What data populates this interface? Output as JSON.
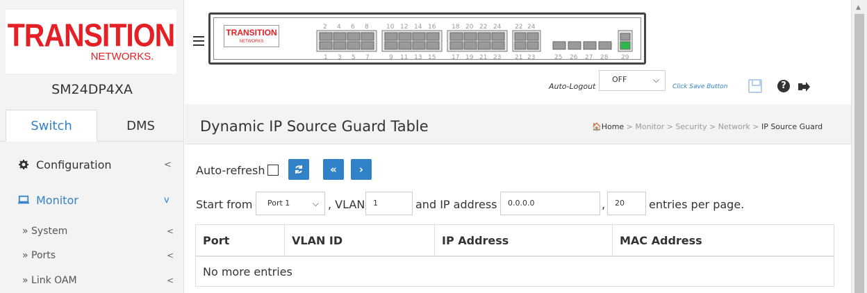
{
  "brand": {
    "logo_word": "TRANSITION",
    "logo_sub": "NETWORKS.",
    "mini_logo_word": "TRANSITION",
    "mini_logo_sub": "NETWORKS",
    "red": "#e41f26",
    "accent": "#3282c8"
  },
  "device": {
    "model": "SM24DP4XA",
    "ports_top": [
      "2",
      "4",
      "6",
      "8",
      "10",
      "12",
      "14",
      "16",
      "18",
      "20",
      "22",
      "24",
      "22",
      "24"
    ],
    "ports_bottom": [
      "1",
      "3",
      "5",
      "7",
      "9",
      "11",
      "13",
      "15",
      "17",
      "19",
      "21",
      "23",
      "21",
      "23",
      "25",
      "26",
      "27",
      "28",
      "29"
    ]
  },
  "sidebar": {
    "tabs": [
      {
        "label": "Switch",
        "active": true
      },
      {
        "label": "DMS",
        "active": false
      }
    ],
    "items": [
      {
        "label": "Configuration",
        "icon": "gear-icon",
        "chevron": "<"
      },
      {
        "label": "Monitor",
        "icon": "monitor-icon",
        "chevron": "v"
      }
    ],
    "subitems": [
      {
        "label": "» System",
        "chevron": "<"
      },
      {
        "label": "» Ports",
        "chevron": "<"
      },
      {
        "label": "» Link OAM",
        "chevron": "<"
      }
    ]
  },
  "topbar": {
    "auto_logout_label": "Auto-Logout",
    "auto_logout_value": "OFF",
    "click_save_label": "Click Save Button"
  },
  "page": {
    "title": "Dynamic IP Source Guard Table",
    "breadcrumb": {
      "home": "Home",
      "path": " > Monitor > Security > Network > ",
      "current": "IP Source Guard"
    }
  },
  "controls": {
    "auto_refresh_label": "Auto-refresh",
    "auto_refresh_checked": false,
    "refresh_glyph": "⇄",
    "first_glyph": "«",
    "next_glyph": "›",
    "start_from_label": "Start from",
    "port_value": "Port 1",
    "vlan_label": ", VLAN",
    "vlan_value": "1",
    "ip_label": "and IP address",
    "ip_value": "0.0.0.0",
    "comma": ",",
    "entries_value": "20",
    "entries_label": "entries per page."
  },
  "table": {
    "columns": [
      "Port",
      "VLAN ID",
      "IP Address",
      "MAC Address"
    ],
    "empty_message": "No more entries"
  }
}
